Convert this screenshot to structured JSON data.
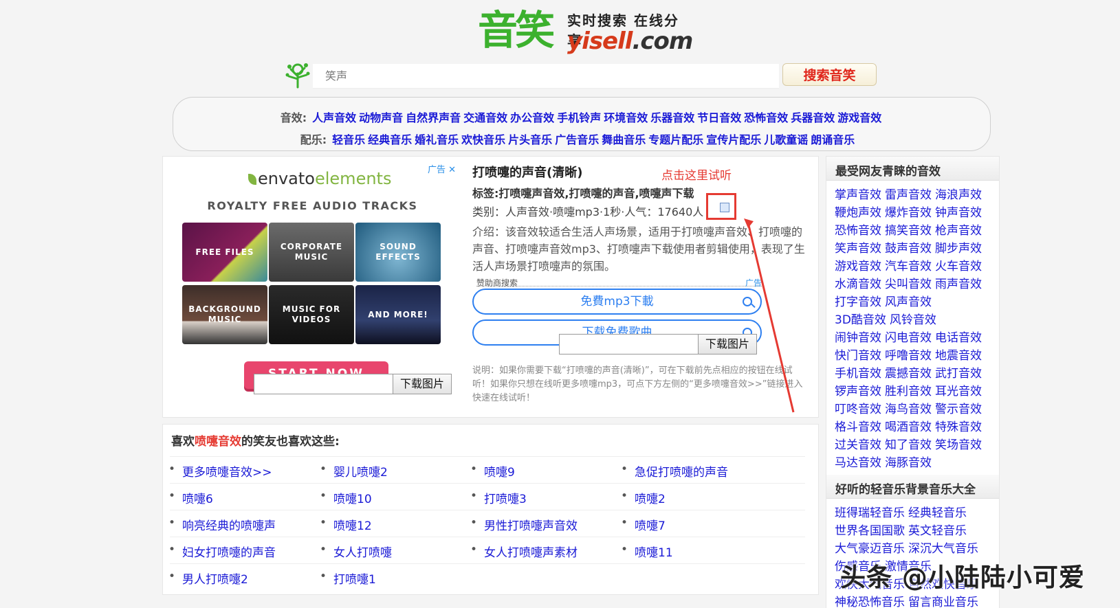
{
  "logo": {
    "cn": "音笑",
    "slogan": "实时搜索 在线分享",
    "domain_a": "yisell",
    "domain_b": ".com"
  },
  "search": {
    "placeholder": "笑声",
    "button": "搜索音笑"
  },
  "nav": {
    "row1_label": "音效:",
    "row1": [
      "人声音效",
      "动物声音",
      "自然界声音",
      "交通音效",
      "办公音效",
      "手机铃声",
      "环境音效",
      "乐器音效",
      "节日音效",
      "恐怖音效",
      "兵器音效",
      "游戏音效"
    ],
    "row2_label": "配乐:",
    "row2": [
      "轻音乐",
      "经典音乐",
      "婚礼音乐",
      "欢快音乐",
      "片头音乐",
      "广告音乐",
      "舞曲音乐",
      "专题片配乐",
      "宣传片配乐",
      "儿歌童谣",
      "朗诵音乐"
    ]
  },
  "ad": {
    "tag": "广告",
    "brand_a": "envato",
    "brand_b": "elements",
    "subtitle": "ROYALTY FREE AUDIO TRACKS",
    "tiles": [
      "FREE FILES",
      "CORPORATE MUSIC",
      "SOUND EFFECTS",
      "BACKGROUND MUSIC",
      "MUSIC FOR VIDEOS",
      "AND MORE!"
    ],
    "cta": "START NOW"
  },
  "download_widget": {
    "button": "下载图片"
  },
  "detail": {
    "title": "打喷嚏的声音(清晰)",
    "hint": "点击这里试听",
    "tags": "标签:打喷嚏声音效,打喷嚏的声音,喷嚏声下载",
    "meta": "类别：人声音效·喷嚏mp3·1秒·人气：17640人",
    "intro": "介绍：该音效较适合生活人声场景，适用于打喷嚏声音效、打喷嚏的声音、打喷嚏声音效mp3、打喷嚏声下载使用者剪辑使用，表现了生活人声场景打喷嚏声的氛围。",
    "sponsor": "赞助商搜索",
    "sponsor_ad": "广告",
    "pill1": "免費mp3下載",
    "pill2": "下载免费歌曲",
    "note": "说明：如果你需要下载“打喷嚏的声音(清晰)”，可在下载前先点相应的按钮在线试听！如果你只想在线听更多喷嚏mp3，可点下方左侧的“更多喷嚏音效>>”链接进入快速在线试听！"
  },
  "related": {
    "head_a": "喜欢",
    "head_hl": "喷嚏音效",
    "head_b": "的笑友也喜欢这些:",
    "rows": [
      [
        "更多喷嚏音效>>",
        "婴儿喷嚏2",
        "喷嚏9",
        "急促打喷嚏的声音"
      ],
      [
        "喷嚏6",
        "喷嚏10",
        "打喷嚏3",
        "喷嚏2"
      ],
      [
        "响亮经典的喷嚏声",
        "喷嚏12",
        "男性打喷嚏声音效",
        "喷嚏7"
      ],
      [
        "妇女打喷嚏的声音",
        "女人打喷嚏",
        "女人打喷嚏声素材",
        "喷嚏11"
      ],
      [
        "男人打喷嚏2",
        "打喷嚏1"
      ]
    ]
  },
  "sidebar": {
    "head1": "最受网友青睐的音效",
    "list1": [
      [
        "掌声音效",
        "雷声音效",
        "海浪声效"
      ],
      [
        "鞭炮声效",
        "爆炸音效",
        "钟声音效"
      ],
      [
        "恐怖音效",
        "搞笑音效",
        "枪声音效"
      ],
      [
        "笑声音效",
        "鼓声音效",
        "脚步声效"
      ],
      [
        "游戏音效",
        "汽车音效",
        "火车音效"
      ],
      [
        "水滴音效",
        "尖叫音效",
        "雨声音效"
      ],
      [
        "打字音效",
        "风声音效"
      ],
      [
        "3D酷音效",
        "风铃音效"
      ],
      [
        "闹钟音效",
        "闪电音效",
        "电话音效"
      ],
      [
        "快门音效",
        "呼噜音效",
        "地震音效"
      ],
      [
        "手机音效",
        "震撼音效",
        "武打音效"
      ],
      [
        "锣声音效",
        "胜利音效",
        "耳光音效"
      ],
      [
        "叮咚音效",
        "海鸟音效",
        "警示音效"
      ],
      [
        "格斗音效",
        "喝酒音效",
        "特殊音效"
      ],
      [
        "过关音效",
        "知了音效",
        "笑场音效"
      ],
      [
        "马达音效",
        "海豚音效"
      ]
    ],
    "head2": "好听的轻音乐背景音乐大全",
    "list2": [
      [
        "班得瑞轻音乐",
        "经典轻音乐"
      ],
      [
        "世界各国国歌",
        "英文轻音乐"
      ],
      [
        "大气豪迈音乐",
        "深沉大气音乐"
      ],
      [
        "伤感音乐",
        "激情音乐"
      ],
      [
        "欢快大气音乐",
        "自然欢快音乐"
      ],
      [
        "神秘恐怖音乐",
        "留言商业音乐"
      ]
    ]
  },
  "watermark": "头条 @小陆陆小可爱",
  "colors": {
    "accent_red": "#e53a32",
    "link_blue": "#1a1ad6",
    "logo_green": "#3cb12e",
    "pill_blue": "#2d7ff0"
  }
}
